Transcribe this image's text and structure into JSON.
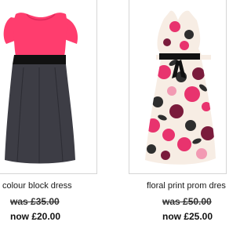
{
  "products": [
    {
      "name": "colour block dress",
      "was_price": "was £35.00",
      "now_price": "now £20.00",
      "colors": {
        "bodice": "#ff3d6e",
        "band": "#111111",
        "skirt": "#3d3d45"
      }
    },
    {
      "name": "floral print prom dres",
      "was_price": "was £50.00",
      "now_price": "now £25.00",
      "colors": {
        "fabric": "#f7ede4",
        "flower_pink": "#e8336e",
        "flower_dark": "#7a1b3c",
        "leaf": "#2e2e2e",
        "sash": "#111111"
      }
    }
  ]
}
